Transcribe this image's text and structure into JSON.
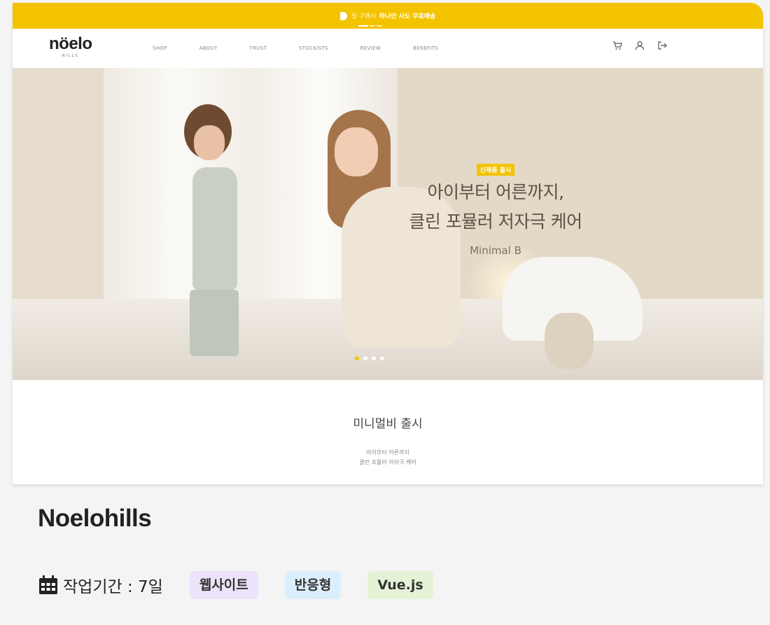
{
  "announcement": {
    "pre_text": "첫 구매시",
    "highlight_text": "하나만 사도 무료배송"
  },
  "header": {
    "logo": "nöelo",
    "logo_sub": "HILLS",
    "menu": [
      "SHOP",
      "ABOUT",
      "TRUST",
      "STOCKISTS",
      "REVIEW",
      "BENEFITS"
    ],
    "icons": [
      "cart-icon",
      "user-icon",
      "logout-icon"
    ]
  },
  "hero": {
    "badge": "신제품 출시",
    "title_line1": "아이부터 어른까지,",
    "title_line2": "클린 포뮬러 저자극 케어",
    "subtitle": "Minimal B",
    "slide_count": 4,
    "active_slide": 1
  },
  "promo": {
    "title": "미니멀비 출시",
    "line1": "아이부터 어른까지",
    "line2": "클린 포뮬러 저자극 케어"
  },
  "project": {
    "name": "Noelohills",
    "period": "작업기간 : 7일",
    "tags": [
      "웹사이트",
      "반응형",
      "Vue.js"
    ]
  },
  "colors": {
    "accent": "#f3c300",
    "tag_purple": "#ece3fa",
    "tag_blue": "#dbeefc",
    "tag_green": "#e4f3d6"
  }
}
